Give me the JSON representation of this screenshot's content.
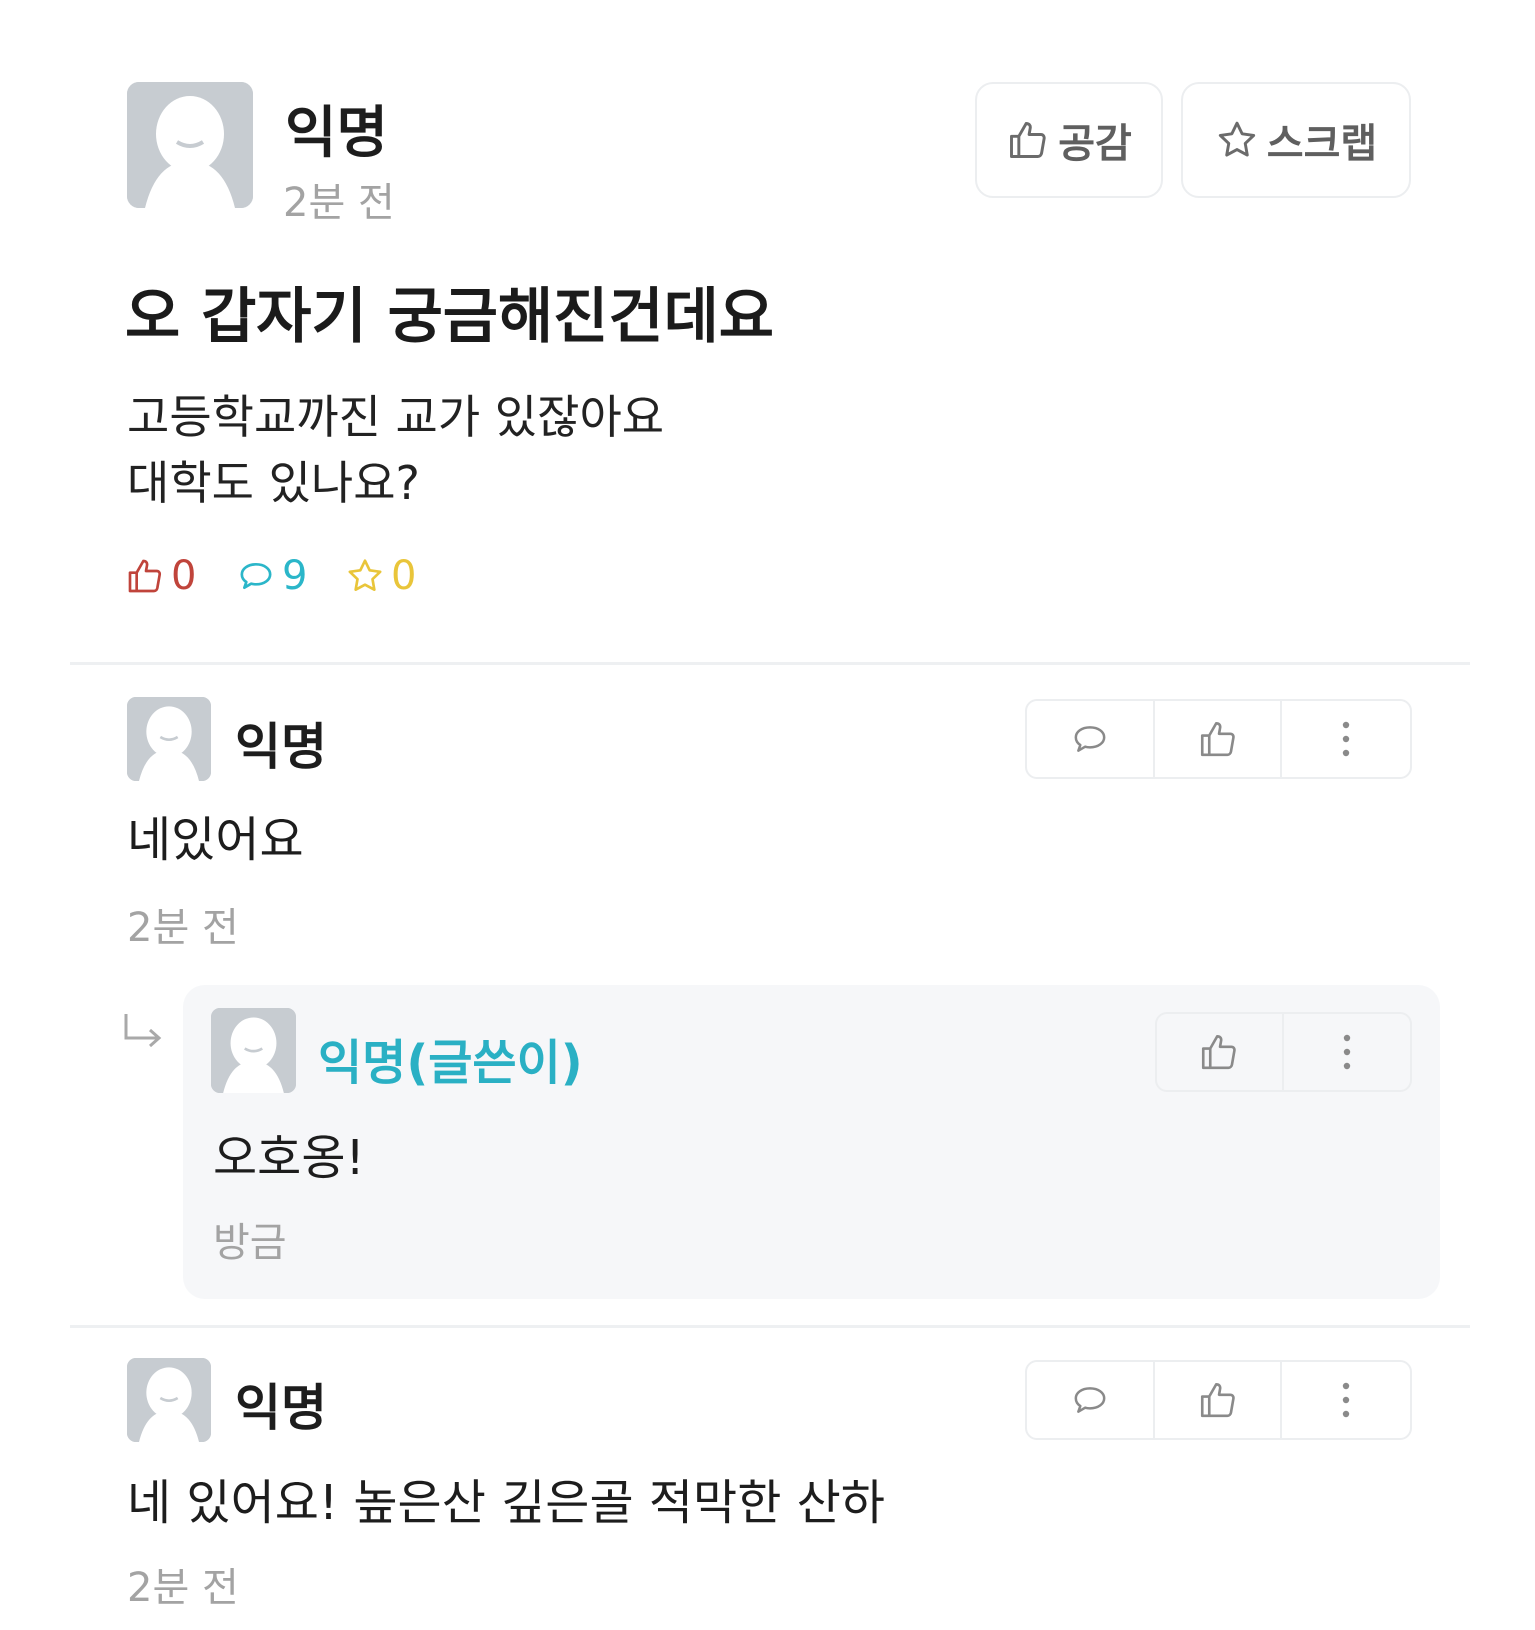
{
  "post": {
    "author": "익명",
    "time": "2분 전",
    "like_button": "공감",
    "scrap_button": "스크랩",
    "title": "오 갑자기 궁금해진건데요",
    "body_lines": [
      "고등학교까진 교가 있잖아요",
      "대학도 있나요?"
    ],
    "stats": {
      "likes": "0",
      "comments": "9",
      "scraps": "0"
    },
    "colors": {
      "like": "#c0443b",
      "comment": "#2bb6c9",
      "scrap": "#e9c53a"
    }
  },
  "comments": [
    {
      "author": "익명",
      "text": "네있어요",
      "time": "2분 전"
    },
    {
      "author": "익명",
      "text": "네 있어요! 높은산 깊은골 적막한 산하",
      "time": "2분 전"
    }
  ],
  "reply": {
    "author": "익명(글쓴이)",
    "text": "오호옹!",
    "time": "방금",
    "author_color": "#2ab0c4"
  }
}
